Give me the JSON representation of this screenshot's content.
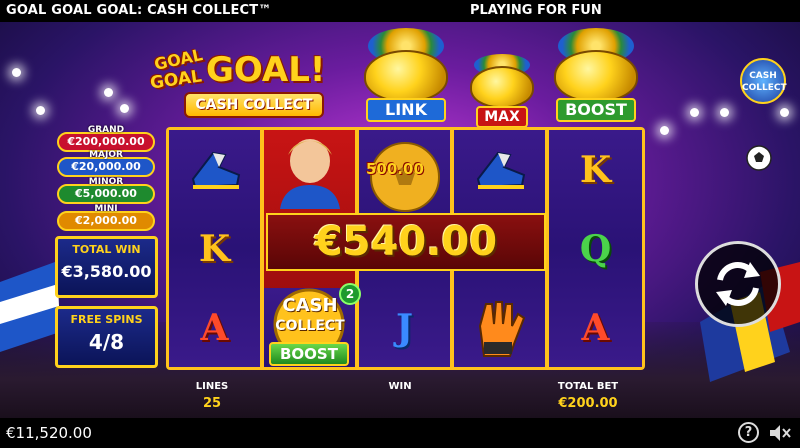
{
  "header": {
    "title": "GOAL GOAL GOAL: CASH COLLECT™",
    "mode": "PLAYING FOR FUN"
  },
  "logo": {
    "line1": "GOAL",
    "line2": "GOAL",
    "line3": "GOAL!",
    "line4": "CASH COLLECT"
  },
  "pots": [
    {
      "label": "LINK",
      "color": "#1e6ad8"
    },
    {
      "label": "MAX",
      "color": "#c81414"
    },
    {
      "label": "BOOST",
      "color": "#2e9a2e"
    }
  ],
  "cash_collect_badge": {
    "line1": "CASH",
    "line2": "COLLECT"
  },
  "jackpots": [
    {
      "label": "GRAND",
      "value": "€200,000.00",
      "color": "#c8102e"
    },
    {
      "label": "MAJOR",
      "value": "€20,000.00",
      "color": "#1e56c8"
    },
    {
      "label": "MINOR",
      "value": "€5,000.00",
      "color": "#1e8a2e"
    },
    {
      "label": "MINI",
      "value": "€2,000.00",
      "color": "#e08a00"
    }
  ],
  "total_win": {
    "label": "TOTAL WIN",
    "value": "€3,580.00"
  },
  "free_spins": {
    "label": "FREE SPINS",
    "value": "4/8"
  },
  "reels": {
    "ball_value": "500.00",
    "win_amount": "€540.00",
    "symbols": {
      "r1": [
        "boot",
        "K",
        "A"
      ],
      "r2": [
        "player",
        "player",
        "cash-collect"
      ],
      "r3": [
        "ball",
        "ball",
        "J"
      ],
      "r4": [
        "boot",
        "",
        "glove"
      ],
      "r5": [
        "K",
        "Q",
        "A"
      ]
    },
    "cash_collect_line1": "CASH",
    "cash_collect_line2": "COLLECT",
    "multiplier": "2",
    "boost_label": "BOOST"
  },
  "info": {
    "lines_label": "LINES",
    "lines_value": "25",
    "win_label": "WIN",
    "total_bet_label": "TOTAL BET",
    "total_bet_value": "€200.00"
  },
  "footer": {
    "balance": "€11,520.00",
    "help": "?"
  }
}
